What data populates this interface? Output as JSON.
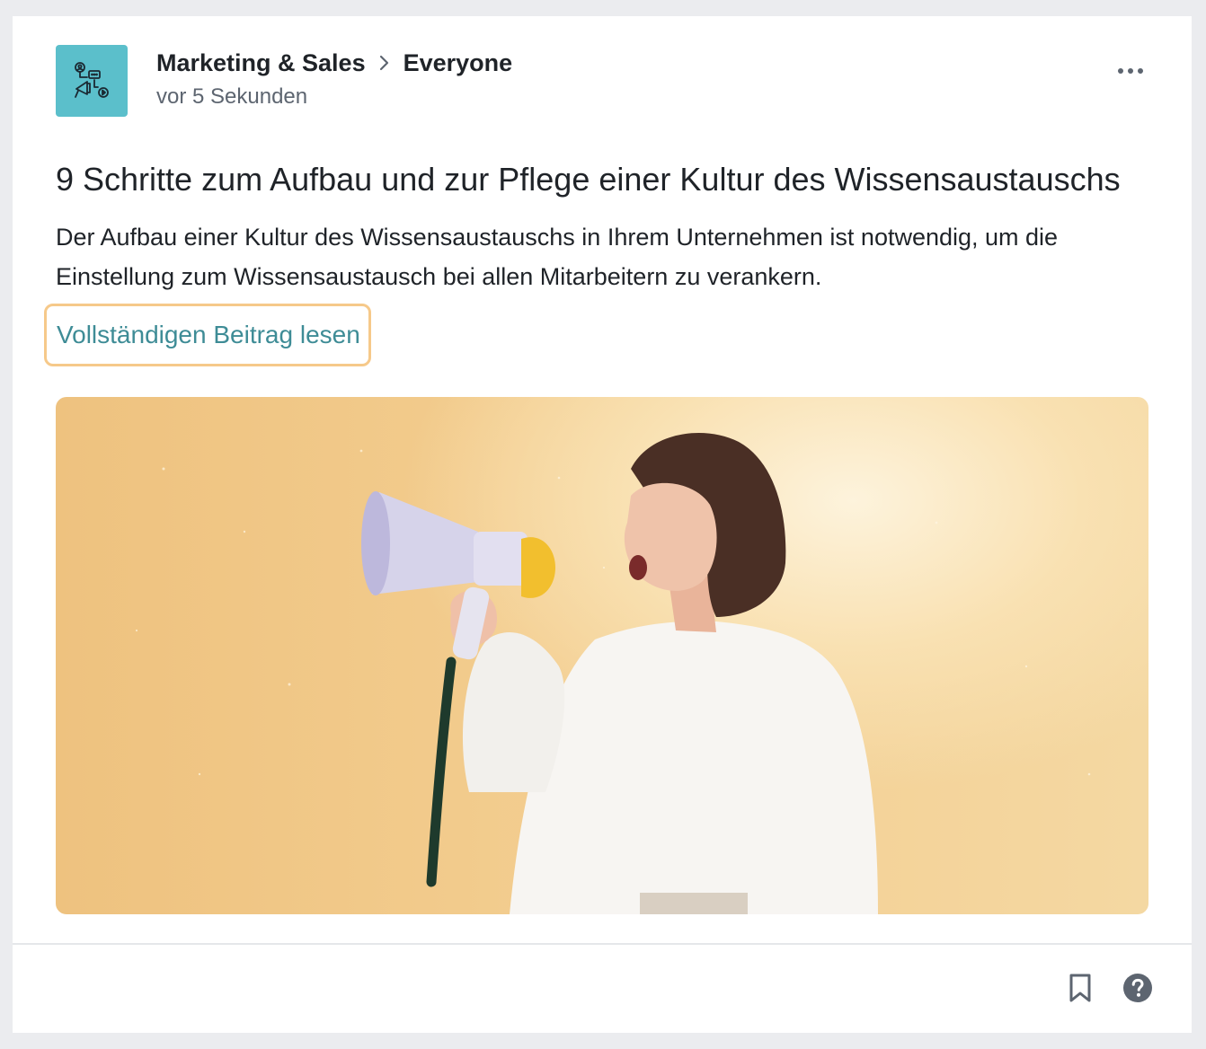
{
  "post": {
    "space_icon": "marketing-megaphone-icon",
    "breadcrumb": {
      "space": "Marketing & Sales",
      "separator_icon": "chevron-right-icon",
      "audience": "Everyone"
    },
    "timestamp": "vor 5 Sekunden",
    "menu_icon": "more-horizontal-icon",
    "title": "9 Schritte zum Aufbau und zur Pflege einer Kultur des Wissensaustauschs",
    "excerpt": "Der Aufbau einer Kultur des Wissensaustauschs in Ihrem Unternehmen ist notwendig, um die Einstellung zum Wissensaustausch bei allen Mitarbeitern zu verankern.",
    "read_more": "Vollständigen Beitrag lesen",
    "image_subject": "woman-with-megaphone-photo"
  },
  "footer": {
    "bookmark_icon": "bookmark-icon",
    "help_icon": "help-circle-icon"
  },
  "colors": {
    "space_avatar_bg": "#5bbfcb",
    "link": "#3e8c96",
    "focus_ring": "#f6c98a",
    "hero_bg": "#f3cd8f"
  }
}
